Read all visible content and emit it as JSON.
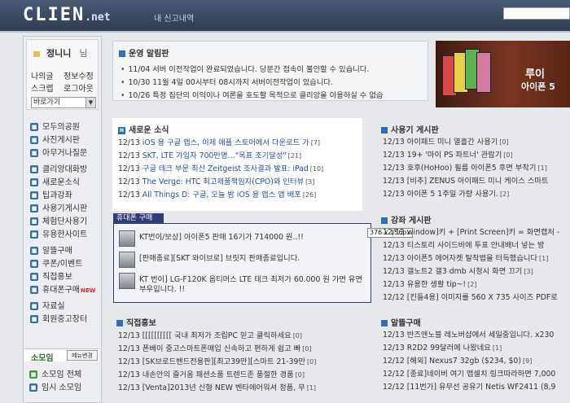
{
  "header": {
    "logo_main": "CLIEN",
    "logo_suffix": ".net",
    "subtitle": "내 신고내역"
  },
  "sidebar": {
    "user_name": "정니니",
    "user_suffix": "님",
    "links": [
      "나의글",
      "정보수정",
      "스크랩",
      "로그아웃"
    ],
    "shortcut_select": "바로가기",
    "menu": [
      {
        "label": "모두의공원",
        "new": false
      },
      {
        "label": "사진게시판",
        "new": false
      },
      {
        "label": "아무거나질문",
        "new": false
      },
      {
        "gap": true
      },
      {
        "label": "클리앙대화방",
        "new": false
      },
      {
        "label": "새로운소식",
        "new": false
      },
      {
        "label": "팁과강좌",
        "new": false
      },
      {
        "label": "사용기게시판",
        "new": false
      },
      {
        "label": "체험단사용기",
        "new": false
      },
      {
        "label": "유용한사이트",
        "new": false
      },
      {
        "gap": true
      },
      {
        "label": "알뜰구매",
        "new": false
      },
      {
        "label": "쿠폰/이벤트",
        "new": false
      },
      {
        "label": "직접홍보",
        "new": false
      },
      {
        "label": "휴대폰구매",
        "new": true,
        "new_label": "NEW"
      },
      {
        "gap": true
      },
      {
        "label": "자료실",
        "new": false
      },
      {
        "label": "회원중고장터",
        "new": false
      }
    ],
    "somoim_title": "소모임",
    "somoim_button": "메뉴변경",
    "somoim_items": [
      "소모임 전체",
      "임시 소모임"
    ]
  },
  "notice": {
    "title": "운영 알림판",
    "items": [
      "11/04 서버 이전작업이 완료되었습니다. 당분간 접속이 불안할 수 있습니다.",
      "10/30 11월 4일 00시부터 08시까지 서버이전작업이 있습니다.",
      "10/26 특정 집단의 이익이나 여론을 호도할 목적으로 클리앙을 이용하실 수 없습"
    ]
  },
  "news": {
    "title": "새로운 소식",
    "rows": [
      {
        "date": "12/13",
        "title": "iOS 용 구글 맵스, 이제 애플 스토어에서 다운로드 가",
        "count": "[7]"
      },
      {
        "date": "12/13",
        "title": "SKT, LTE 가입자 700만명…\"목표 조기달성\"",
        "count": "[21]"
      },
      {
        "date": "12/13",
        "title": "구글 테크 부문 최신 Zeitgeist 조사결과 발표: iPad",
        "count": "[10]"
      },
      {
        "date": "12/13",
        "title": "The Verge: HTC 최고제품책임자(CPO)와 인터뷰",
        "count": "[3]"
      },
      {
        "date": "12/13",
        "title": "All Things D: 구글, 오늘 밤 iOS 용 맵스 앱 배포",
        "count": "[26]"
      }
    ]
  },
  "phone": {
    "tab": "휴대폰 구매",
    "items": [
      "KT번이/보상] 아이폰5 판매 16기가 714000 원..!!",
      "[판매종료][SKT 와이브로] 브릿지 판매종료입니다.",
      "KT 번이] LG-F120K 옵티머스 LTE 태크 최저가 60.000 원 가면 유면 부우입니다. !!"
    ]
  },
  "size_tooltip": "376 x 156px",
  "direct": {
    "title": "직접홍보",
    "rows": [
      {
        "date": "12/13",
        "title": "[[[[[[[[[[ 국내 최저가 조립PC 믿고 클릭하세요",
        "count": "[0]"
      },
      {
        "date": "12/13",
        "title": "폰베이 중고스마트폰매입 신속하고 편하게 쉽고 빠",
        "count": "[0]"
      },
      {
        "date": "12/13",
        "title": "[SK브로드밴드전용판][최고39만][스마트 21-39만",
        "count": "[0]"
      },
      {
        "date": "12/13",
        "title": "내손안의 즐거움 패션소품 트렌드존 풍절한 경품",
        "count": "[0]"
      },
      {
        "date": "12/13",
        "title": "[Venta]2013년 신형 NEW 벤타에어워셔 정품, 무",
        "count": "[1]"
      }
    ]
  },
  "ad": {
    "title": "루이",
    "subtitle": "아이폰 5"
  },
  "review": {
    "title": "사용기 게시판",
    "rows": [
      {
        "date": "12/13",
        "title": "아이패드 미니 열흘간 사용기",
        "count": "[0]"
      },
      {
        "date": "12/13",
        "title": "19+ '마이 PS 파트너' 관람기",
        "count": "[0]"
      },
      {
        "date": "12/13",
        "title": "호후(HoHoo) 필름 아이폰5 후면 부착기",
        "count": "[1]"
      },
      {
        "date": "12/13",
        "title": "[비추] ZENUS 아이패드 미니 케이스 스마트 ",
        "count": ""
      },
      {
        "date": "12/13",
        "title": "아이폰 5 1주일 가량 사용기.",
        "count": "[2]"
      }
    ]
  },
  "lecture": {
    "title": "강좌 게시판",
    "rows": [
      {
        "date": "12/13",
        "title": "window]키 + [Print Screen]키 = 화면캡처 -",
        "count": ""
      },
      {
        "date": "12/13",
        "title": "티스토리 사이드바에 투표 안내배너 넣는 방",
        "count": ""
      },
      {
        "date": "12/13",
        "title": "아이폰5 에어자켓 탈착법을 터득했습니다",
        "count": "[1]"
      },
      {
        "date": "12/13",
        "title": "갤노트2 갤3 dmb 시청시 화면 끄기",
        "count": "[3]"
      },
      {
        "date": "12/13",
        "title": "유용한 생활 tip~!",
        "count": "[2]"
      },
      {
        "date": "12/12",
        "title": "[킨들4용] 이미지를 560 X 735 사이즈 PDF로",
        "count": ""
      }
    ]
  },
  "deals": {
    "title": "알뜰구매",
    "rows": [
      {
        "date": "12/13",
        "title": "반즈앤노블 레노버샵에서 세일중입니다. x230",
        "count": ""
      },
      {
        "date": "12/13",
        "title": "R2D2 99달러에 나왔네요",
        "count": "[1]"
      },
      {
        "date": "12/12",
        "title": "[해외] Nexus7 32gb ($234, $0)",
        "count": "[9]"
      },
      {
        "date": "12/12",
        "title": "[종료]네이버 여기 맵셀치 링크따라하면 7,000",
        "count": ""
      },
      {
        "date": "12/12",
        "title": "[11번가] 유무선 공유기 Netis WF2411 (8,9",
        "count": ""
      }
    ]
  }
}
